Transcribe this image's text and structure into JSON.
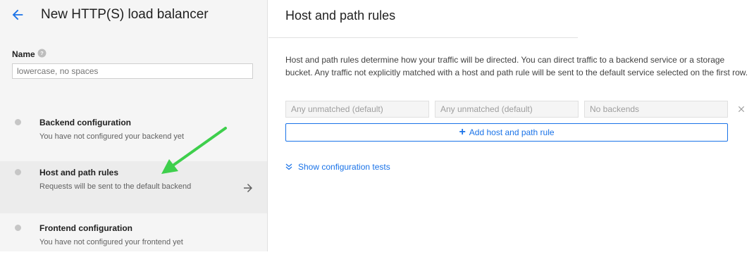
{
  "header": {
    "title": "New HTTP(S) load balancer"
  },
  "name_field": {
    "label": "Name",
    "placeholder": "lowercase, no spaces",
    "value": ""
  },
  "steps": [
    {
      "title": "Backend configuration",
      "description": "You have not configured your backend yet"
    },
    {
      "title": "Host and path rules",
      "description": "Requests will be sent to the default backend"
    },
    {
      "title": "Frontend configuration",
      "description": "You have not configured your frontend yet"
    }
  ],
  "panel": {
    "title": "Host and path rules",
    "description": "Host and path rules determine how your traffic will be directed. You can direct traffic to a backend service or a storage bucket. Any traffic not explicitly matched with a host and path rule will be sent to the default service selected on the first row.",
    "rule_row": {
      "hosts": "Any unmatched (default)",
      "paths": "Any unmatched (default)",
      "backend": "No backends"
    },
    "add_rule_label": "Add host and path rule",
    "show_tests_label": "Show configuration tests"
  },
  "colors": {
    "accent": "#1a73e8",
    "annotation_arrow": "#34c759"
  },
  "icons": [
    "back-arrow-icon",
    "help-icon",
    "arrow-right-icon",
    "close-icon",
    "plus-icon",
    "chevron-down-double-icon"
  ]
}
